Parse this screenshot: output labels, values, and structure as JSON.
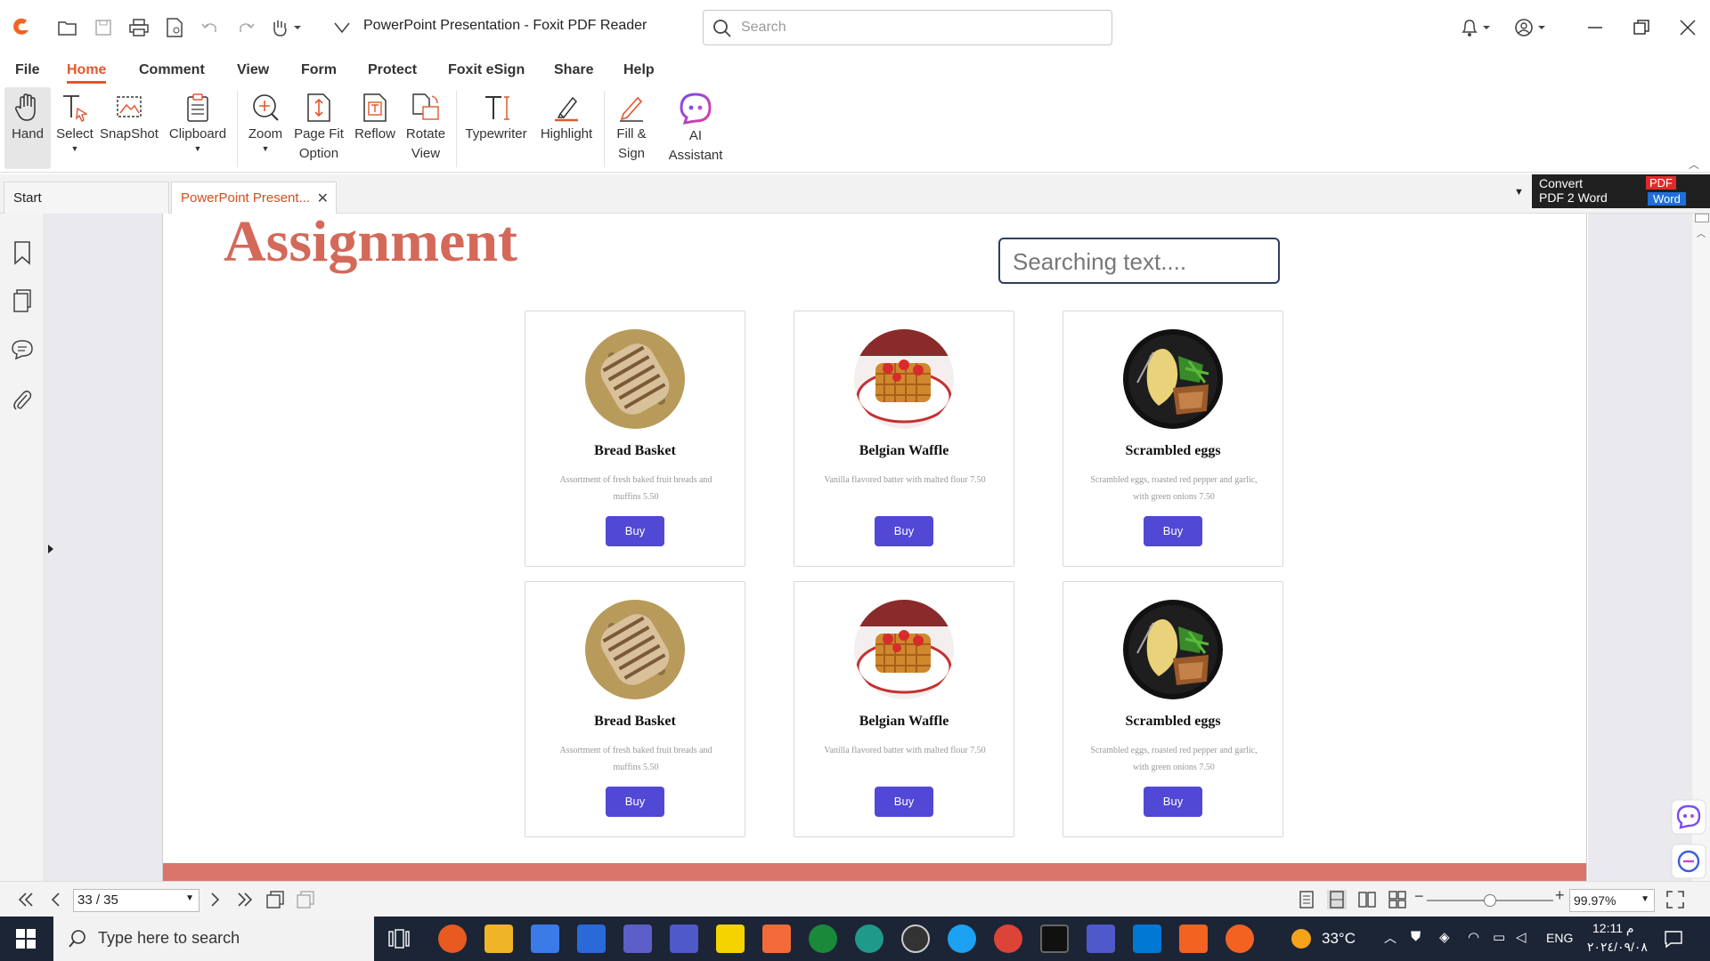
{
  "window": {
    "title": "PowerPoint Presentation - Foxit PDF Reader",
    "search_placeholder": "Search"
  },
  "menu": {
    "tabs": [
      "File",
      "Home",
      "Comment",
      "View",
      "Form",
      "Protect",
      "Foxit eSign",
      "Share",
      "Help"
    ],
    "active": "Home"
  },
  "ribbon": {
    "hand": "Hand",
    "select": "Select",
    "snapshot": "SnapShot",
    "clipboard": "Clipboard",
    "zoom": "Zoom",
    "pagefit": "Page Fit\nOption",
    "reflow": "Reflow",
    "rotate": "Rotate\nView",
    "typewriter": "Typewriter",
    "highlight": "Highlight",
    "fillsign": "Fill &\nSign",
    "ai": "AI\nAssistant"
  },
  "doc_tabs": {
    "start": "Start",
    "current": "PowerPoint Present..."
  },
  "convert_banner": {
    "line1": "Convert",
    "line2": "PDF 2 Word",
    "badge_pdf": "PDF",
    "badge_word": "Word"
  },
  "page": {
    "title": "Assignment",
    "search_placeholder": "Searching text....",
    "cards": [
      {
        "name": "Bread Basket",
        "desc": "Assortment of fresh baked fruit breads and muffins 5.50",
        "button": "Buy"
      },
      {
        "name": "Belgian Waffle",
        "desc": "Vanilla flavored batter with malted flour 7.50",
        "button": "Buy"
      },
      {
        "name": "Scrambled eggs",
        "desc": "Scrambled eggs, roasted red pepper and garlic, with green onions 7.50",
        "button": "Buy"
      },
      {
        "name": "Bread Basket",
        "desc": "Assortment of fresh baked fruit breads and muffins 5.50",
        "button": "Buy"
      },
      {
        "name": "Belgian Waffle",
        "desc": "Vanilla flavored batter with malted flour 7.50",
        "button": "Buy"
      },
      {
        "name": "Scrambled eggs",
        "desc": "Scrambled eggs, roasted red pepper and garlic, with green onions 7.50",
        "button": "Buy"
      }
    ]
  },
  "status": {
    "page": "33 / 35",
    "zoom": "99.97%"
  },
  "taskbar": {
    "search_placeholder": "Type here to search",
    "weather": "33°C",
    "lang": "ENG",
    "time": "12:11 م",
    "date": "٢٠٢٤/٠٩/٠٨"
  },
  "colors": {
    "accent": "#e0582e",
    "title": "#d4695a",
    "buy_button": "#5148d6",
    "taskbar": "#1c2536"
  }
}
